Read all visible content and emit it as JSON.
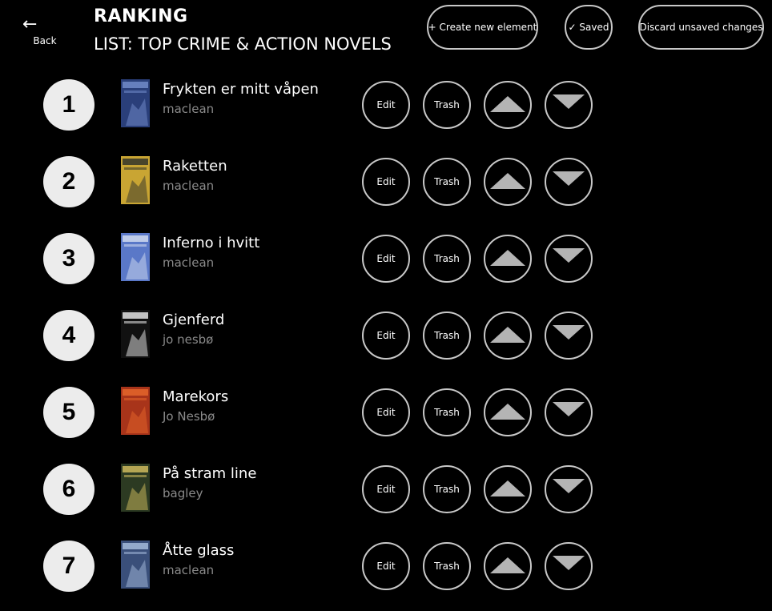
{
  "header": {
    "back_icon": "←",
    "back_label": "Back",
    "title": "RANKING",
    "subtitle": "LIST: TOP CRIME & ACTION NOVELS",
    "create_label": "+ Create new element",
    "saved_label": "✓ Saved",
    "discard_label": "Discard unsaved changes"
  },
  "row_buttons": {
    "edit_label": "Edit",
    "trash_label": "Trash"
  },
  "items": [
    {
      "rank": "1",
      "title": "Frykten er mitt våpen",
      "author": "maclean",
      "cover_colors": [
        "#2a3f7a",
        "#6d86c4"
      ]
    },
    {
      "rank": "2",
      "title": "Raketten",
      "author": "maclean",
      "cover_colors": [
        "#c9a533",
        "#3b3b2a"
      ]
    },
    {
      "rank": "3",
      "title": "Inferno i hvitt",
      "author": "maclean",
      "cover_colors": [
        "#5a78c8",
        "#c9d4ec"
      ]
    },
    {
      "rank": "4",
      "title": "Gjenferd",
      "author": "jo nesbø",
      "cover_colors": [
        "#111111",
        "#d8d8d8"
      ]
    },
    {
      "rank": "5",
      "title": "Marekors",
      "author": "Jo Nesbø",
      "cover_colors": [
        "#a8341a",
        "#e0632a"
      ]
    },
    {
      "rank": "6",
      "title": "På stram line",
      "author": "bagley",
      "cover_colors": [
        "#2c3a22",
        "#c4b25a"
      ]
    },
    {
      "rank": "7",
      "title": "Åtte glass",
      "author": "maclean",
      "cover_colors": [
        "#3a4f7a",
        "#9db2d4"
      ]
    }
  ]
}
